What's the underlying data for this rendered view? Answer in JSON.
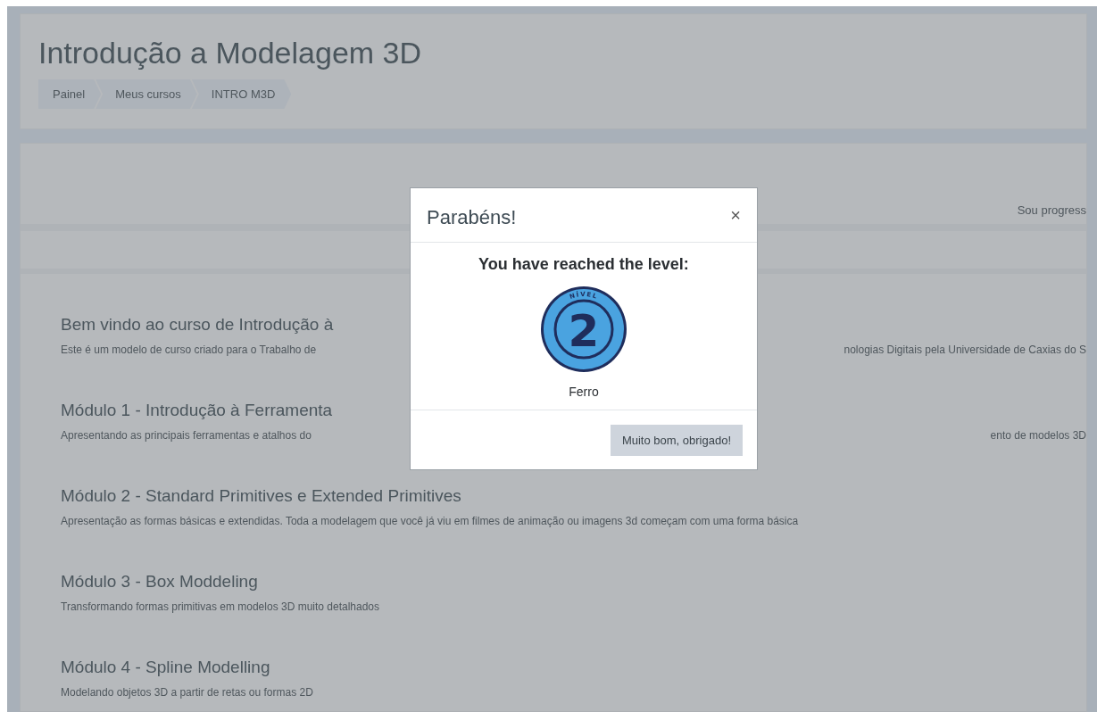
{
  "header": {
    "title": "Introdução a Modelagem 3D",
    "breadcrumb": [
      "Painel",
      "Meus cursos",
      "INTRO M3D"
    ]
  },
  "progress": {
    "label": "Sou progress"
  },
  "sections": [
    {
      "title": "Bem vindo ao curso de Introdução à",
      "description": [
        "Este é um modelo de curso criado para o Trabalho de",
        "nologias Digitais pela Universidade de Caxias do S"
      ]
    },
    {
      "title": "Módulo 1 - Introdução à Ferramenta",
      "description": [
        "Apresentando as principais ferramentas e atalhos do",
        "ento de modelos 3D"
      ]
    },
    {
      "title": "Módulo 2 - Standard Primitives e Extended Primitives",
      "description": [
        "Apresentação as formas básicas e extendidas. Toda a modelagem que você já viu em filmes de animação ou imagens 3d começam com uma forma básica"
      ]
    },
    {
      "title": "Módulo 3 - Box Moddeling",
      "description": [
        "Transformando formas primitivas em modelos 3D muito detalhados"
      ]
    },
    {
      "title": "Módulo 4 - Spline Modelling",
      "description": [
        "Modelando objetos 3D a partir de retas ou formas 2D"
      ]
    }
  ],
  "dialog": {
    "title": "Parabéns!",
    "close": "×",
    "heading": "You have reached the level:",
    "badge": {
      "caption": "NÍVEL",
      "number": "2"
    },
    "level_name": "Ferro",
    "button": "Muito bom, obrigado!"
  }
}
